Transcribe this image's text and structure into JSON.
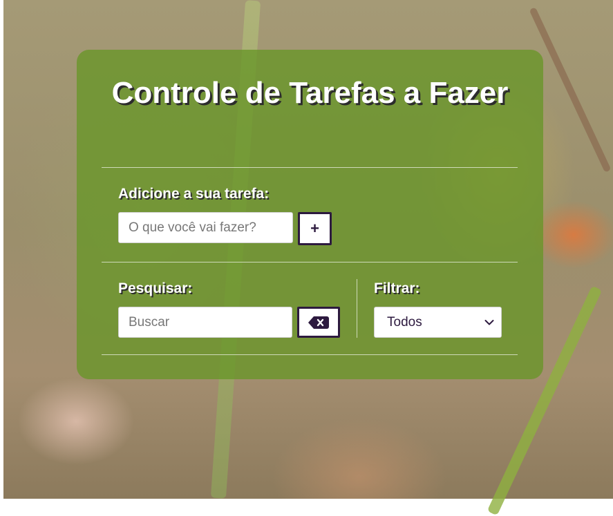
{
  "app": {
    "title": "Controle de Tarefas a Fazer"
  },
  "add_task": {
    "label": "Adicione a sua tarefa:",
    "placeholder": "O que você vai fazer?",
    "value": "",
    "button_label": "+",
    "button_icon": "plus-icon"
  },
  "search": {
    "label": "Pesquisar:",
    "placeholder": "Buscar",
    "value": "",
    "clear_icon": "backspace-icon"
  },
  "filter": {
    "label": "Filtrar:",
    "selected": "Todos",
    "dropdown_icon": "chevron-down-icon"
  },
  "colors": {
    "card_background": "#68962880",
    "button_border": "#2d1a3f",
    "text_primary": "#ffffff",
    "text_shadow": "#2c2c2c"
  }
}
